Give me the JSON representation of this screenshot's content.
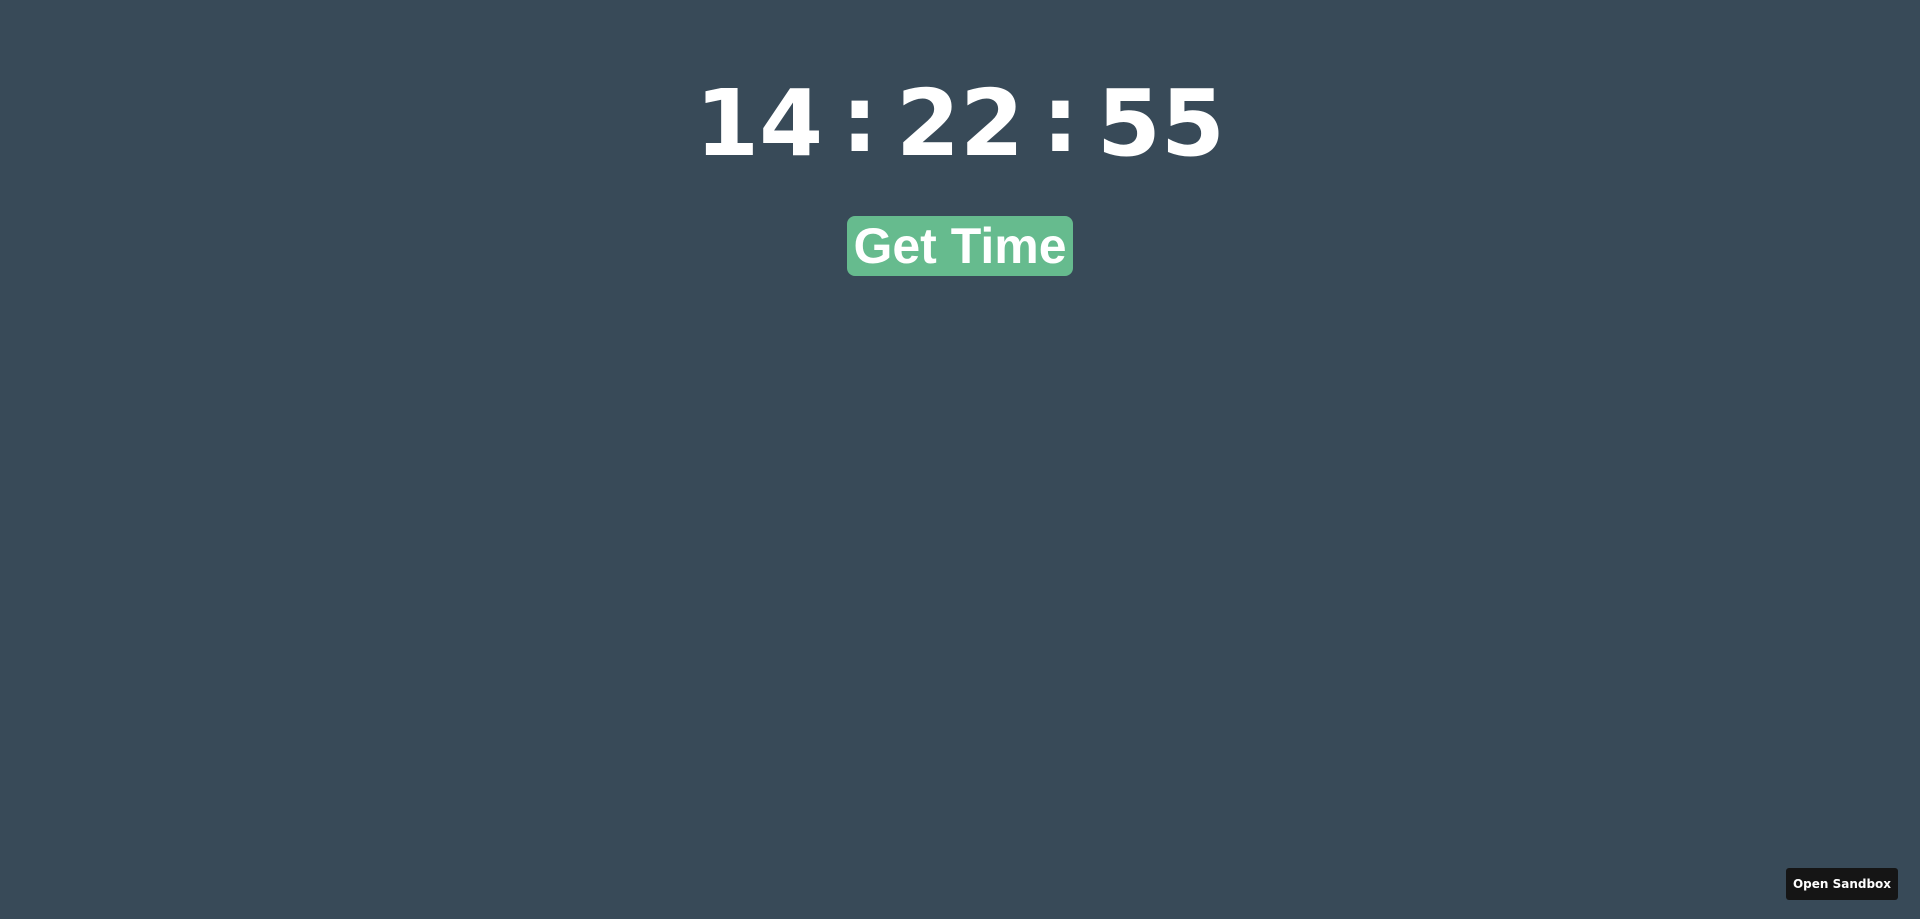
{
  "clock": {
    "hours": "14",
    "separator_1": ":",
    "minutes": "22",
    "separator_2": ":",
    "seconds": "55"
  },
  "actions": {
    "get_time_label": "Get Time"
  },
  "footer": {
    "open_sandbox_label": "Open Sandbox"
  },
  "colors": {
    "background": "#384a58",
    "button_accent": "#66bb8e",
    "text": "#ffffff",
    "sandbox_button_bg": "#151515"
  }
}
